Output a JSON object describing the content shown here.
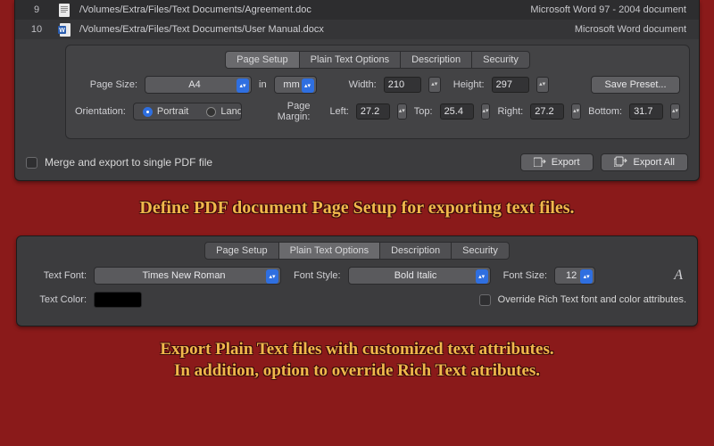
{
  "files": [
    {
      "index": "9",
      "path": "/Volumes/Extra/Files/Text Documents/Agreement.doc",
      "type": "Microsoft Word 97 - 2004 document",
      "icon": "doc"
    },
    {
      "index": "10",
      "path": "/Volumes/Extra/Files/Text Documents/User Manual.docx",
      "type": "Microsoft Word document",
      "icon": "docx"
    }
  ],
  "tabs": {
    "page_setup": "Page Setup",
    "plain_text": "Plain Text Options",
    "description": "Description",
    "security": "Security"
  },
  "page_setup": {
    "page_size_label": "Page Size:",
    "page_size_value": "A4",
    "unit_in": "in",
    "unit_mm": "mm",
    "width_label": "Width:",
    "width_value": "210",
    "height_label": "Height:",
    "height_value": "297",
    "save_preset": "Save Preset...",
    "orientation_label": "Orientation:",
    "orientation_portrait": "Portrait",
    "orientation_landscape": "Landscape",
    "page_margin_label": "Page Margin:",
    "margin_left_label": "Left:",
    "margin_left_value": "27.2",
    "margin_top_label": "Top:",
    "margin_top_value": "25.4",
    "margin_right_label": "Right:",
    "margin_right_value": "27.2",
    "margin_bottom_label": "Bottom:",
    "margin_bottom_value": "31.7"
  },
  "bottom_bar": {
    "merge_label": "Merge and export to single PDF file",
    "export": "Export",
    "export_all": "Export All"
  },
  "plain_text": {
    "text_font_label": "Text Font:",
    "text_font_value": "Times New Roman",
    "font_style_label": "Font Style:",
    "font_style_value": "Bold Italic",
    "font_size_label": "Font Size:",
    "font_size_value": "12",
    "text_color_label": "Text Color:",
    "override_label": "Override Rich Text font and color attributes."
  },
  "captions": {
    "c1": "Define PDF document Page Setup for exporting text files.",
    "c2a": "Export Plain Text files with customized text attributes.",
    "c2b": "In addition, option to override Rich Text atributes."
  },
  "colors": {
    "accent": "#2f6fe0",
    "caption": "#f1b84b",
    "bg": "#8a1a1a"
  }
}
